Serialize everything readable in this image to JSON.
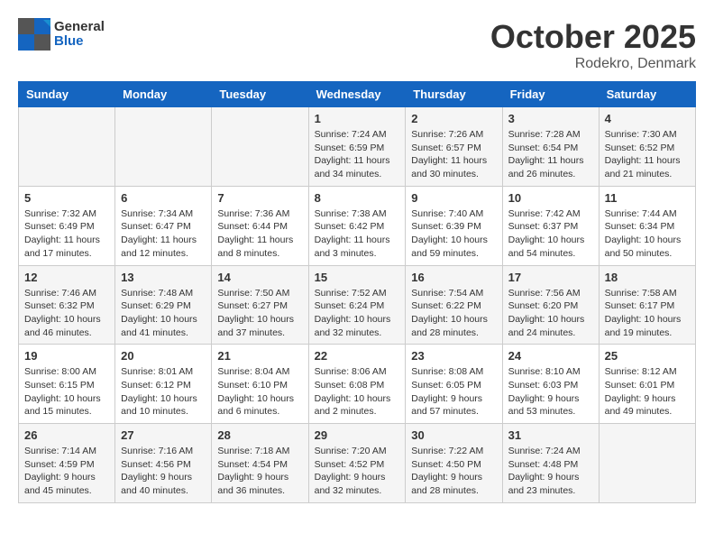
{
  "header": {
    "logo_general": "General",
    "logo_blue": "Blue",
    "month": "October 2025",
    "location": "Rodekro, Denmark"
  },
  "days_of_week": [
    "Sunday",
    "Monday",
    "Tuesday",
    "Wednesday",
    "Thursday",
    "Friday",
    "Saturday"
  ],
  "weeks": [
    {
      "days": [
        {
          "num": "",
          "info": ""
        },
        {
          "num": "",
          "info": ""
        },
        {
          "num": "",
          "info": ""
        },
        {
          "num": "1",
          "info": "Sunrise: 7:24 AM\nSunset: 6:59 PM\nDaylight: 11 hours\nand 34 minutes."
        },
        {
          "num": "2",
          "info": "Sunrise: 7:26 AM\nSunset: 6:57 PM\nDaylight: 11 hours\nand 30 minutes."
        },
        {
          "num": "3",
          "info": "Sunrise: 7:28 AM\nSunset: 6:54 PM\nDaylight: 11 hours\nand 26 minutes."
        },
        {
          "num": "4",
          "info": "Sunrise: 7:30 AM\nSunset: 6:52 PM\nDaylight: 11 hours\nand 21 minutes."
        }
      ]
    },
    {
      "days": [
        {
          "num": "5",
          "info": "Sunrise: 7:32 AM\nSunset: 6:49 PM\nDaylight: 11 hours\nand 17 minutes."
        },
        {
          "num": "6",
          "info": "Sunrise: 7:34 AM\nSunset: 6:47 PM\nDaylight: 11 hours\nand 12 minutes."
        },
        {
          "num": "7",
          "info": "Sunrise: 7:36 AM\nSunset: 6:44 PM\nDaylight: 11 hours\nand 8 minutes."
        },
        {
          "num": "8",
          "info": "Sunrise: 7:38 AM\nSunset: 6:42 PM\nDaylight: 11 hours\nand 3 minutes."
        },
        {
          "num": "9",
          "info": "Sunrise: 7:40 AM\nSunset: 6:39 PM\nDaylight: 10 hours\nand 59 minutes."
        },
        {
          "num": "10",
          "info": "Sunrise: 7:42 AM\nSunset: 6:37 PM\nDaylight: 10 hours\nand 54 minutes."
        },
        {
          "num": "11",
          "info": "Sunrise: 7:44 AM\nSunset: 6:34 PM\nDaylight: 10 hours\nand 50 minutes."
        }
      ]
    },
    {
      "days": [
        {
          "num": "12",
          "info": "Sunrise: 7:46 AM\nSunset: 6:32 PM\nDaylight: 10 hours\nand 46 minutes."
        },
        {
          "num": "13",
          "info": "Sunrise: 7:48 AM\nSunset: 6:29 PM\nDaylight: 10 hours\nand 41 minutes."
        },
        {
          "num": "14",
          "info": "Sunrise: 7:50 AM\nSunset: 6:27 PM\nDaylight: 10 hours\nand 37 minutes."
        },
        {
          "num": "15",
          "info": "Sunrise: 7:52 AM\nSunset: 6:24 PM\nDaylight: 10 hours\nand 32 minutes."
        },
        {
          "num": "16",
          "info": "Sunrise: 7:54 AM\nSunset: 6:22 PM\nDaylight: 10 hours\nand 28 minutes."
        },
        {
          "num": "17",
          "info": "Sunrise: 7:56 AM\nSunset: 6:20 PM\nDaylight: 10 hours\nand 24 minutes."
        },
        {
          "num": "18",
          "info": "Sunrise: 7:58 AM\nSunset: 6:17 PM\nDaylight: 10 hours\nand 19 minutes."
        }
      ]
    },
    {
      "days": [
        {
          "num": "19",
          "info": "Sunrise: 8:00 AM\nSunset: 6:15 PM\nDaylight: 10 hours\nand 15 minutes."
        },
        {
          "num": "20",
          "info": "Sunrise: 8:01 AM\nSunset: 6:12 PM\nDaylight: 10 hours\nand 10 minutes."
        },
        {
          "num": "21",
          "info": "Sunrise: 8:04 AM\nSunset: 6:10 PM\nDaylight: 10 hours\nand 6 minutes."
        },
        {
          "num": "22",
          "info": "Sunrise: 8:06 AM\nSunset: 6:08 PM\nDaylight: 10 hours\nand 2 minutes."
        },
        {
          "num": "23",
          "info": "Sunrise: 8:08 AM\nSunset: 6:05 PM\nDaylight: 9 hours\nand 57 minutes."
        },
        {
          "num": "24",
          "info": "Sunrise: 8:10 AM\nSunset: 6:03 PM\nDaylight: 9 hours\nand 53 minutes."
        },
        {
          "num": "25",
          "info": "Sunrise: 8:12 AM\nSunset: 6:01 PM\nDaylight: 9 hours\nand 49 minutes."
        }
      ]
    },
    {
      "days": [
        {
          "num": "26",
          "info": "Sunrise: 7:14 AM\nSunset: 4:59 PM\nDaylight: 9 hours\nand 45 minutes."
        },
        {
          "num": "27",
          "info": "Sunrise: 7:16 AM\nSunset: 4:56 PM\nDaylight: 9 hours\nand 40 minutes."
        },
        {
          "num": "28",
          "info": "Sunrise: 7:18 AM\nSunset: 4:54 PM\nDaylight: 9 hours\nand 36 minutes."
        },
        {
          "num": "29",
          "info": "Sunrise: 7:20 AM\nSunset: 4:52 PM\nDaylight: 9 hours\nand 32 minutes."
        },
        {
          "num": "30",
          "info": "Sunrise: 7:22 AM\nSunset: 4:50 PM\nDaylight: 9 hours\nand 28 minutes."
        },
        {
          "num": "31",
          "info": "Sunrise: 7:24 AM\nSunset: 4:48 PM\nDaylight: 9 hours\nand 23 minutes."
        },
        {
          "num": "",
          "info": ""
        }
      ]
    }
  ]
}
